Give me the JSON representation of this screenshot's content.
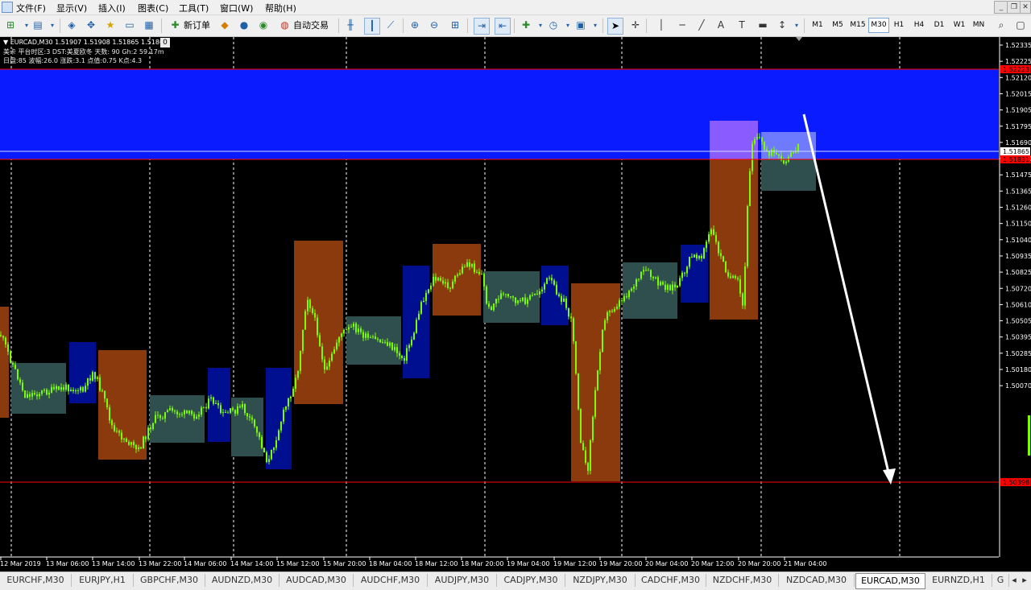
{
  "menu": [
    "文件(F)",
    "显示(V)",
    "插入(I)",
    "图表(C)",
    "工具(T)",
    "窗口(W)",
    "帮助(H)"
  ],
  "toolbar": {
    "new_order": "新订单",
    "auto_trade": "自动交易",
    "text_tool": "A",
    "timeframes": [
      "M1",
      "M5",
      "M15",
      "M30",
      "H1",
      "H4",
      "D1",
      "W1",
      "MN"
    ],
    "active_timeframe": "M30"
  },
  "chart": {
    "header": "EURCAD,M30  1.51907 1.51908 1.51865 1.51865",
    "info_line_2": "美卡 平台时区:3  DST:美夏欧冬 天数: 90  Gh:2  59.17m",
    "info_line_3": "日盘:85 波幅:26.0 涨跌:3.1 点值:0.75 K点:4.3",
    "zero_box": "0",
    "current_price": "1.51865",
    "colors": {
      "grid": "#ffffff",
      "bullish": "#7cfc00",
      "blue_zone": "#0a1cff",
      "red_line": "#ff0000"
    },
    "tag_upper": "1.52223",
    "tag_middle": "1.51831",
    "tag_lower": "1.50398",
    "y_axis_labels": [
      "1.52335",
      "1.52225",
      "1.52120",
      "1.52015",
      "1.51905",
      "1.51795",
      "1.51690",
      "1.51580",
      "1.51475",
      "1.51365",
      "1.51260",
      "1.51150",
      "1.51040",
      "1.50935",
      "1.50825",
      "1.50720",
      "1.50610",
      "1.50505",
      "1.50395",
      "1.50285",
      "1.50180",
      "1.50070"
    ],
    "x_axis_labels": [
      "12 Mar 2019",
      "13 Mar 06:00",
      "13 Mar 14:00",
      "13 Mar 22:00",
      "14 Mar 06:00",
      "14 Mar 14:00",
      "15 Mar 12:00",
      "15 Mar 20:00",
      "18 Mar 04:00",
      "18 Mar 12:00",
      "18 Mar 20:00",
      "19 Mar 04:00",
      "19 Mar 12:00",
      "19 Mar 20:00",
      "20 Mar 04:00",
      "20 Mar 12:00",
      "20 Mar 20:00",
      "21 Mar 04:00"
    ]
  },
  "tabs": [
    "EURCHF,M30",
    "EURJPY,H1",
    "GBPCHF,M30",
    "AUDNZD,M30",
    "AUDCAD,M30",
    "AUDCHF,M30",
    "AUDJPY,M30",
    "CADJPY,M30",
    "NZDJPY,M30",
    "CADCHF,M30",
    "NZDCHF,M30",
    "NZDCAD,M30",
    "EURCAD,M30",
    "EURNZD,H1",
    "G"
  ],
  "active_tab": "EURCAD,M30"
}
